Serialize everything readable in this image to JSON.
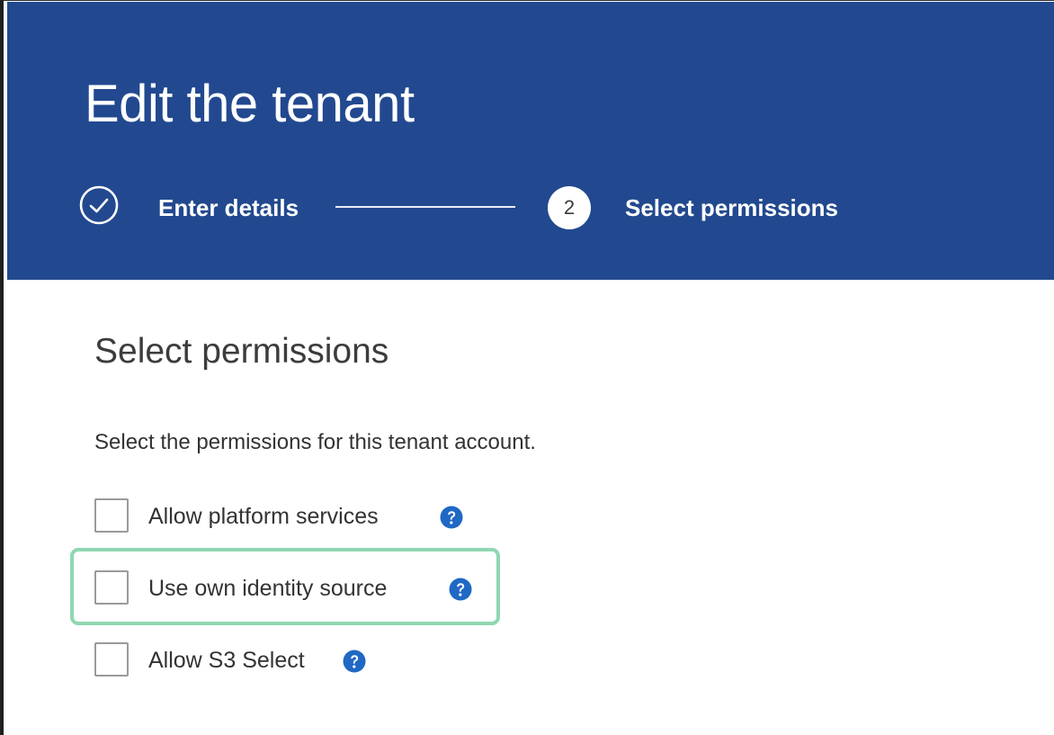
{
  "header": {
    "title": "Edit the tenant",
    "background_color": "#22498f"
  },
  "stepper": {
    "steps": [
      {
        "label": "Enter details",
        "state": "completed",
        "icon": "check-circle-icon"
      },
      {
        "number": "2",
        "label": "Select permissions",
        "state": "active"
      }
    ]
  },
  "content": {
    "section_title": "Select permissions",
    "description": "Select the permissions for this tenant account.",
    "options": [
      {
        "label": "Allow platform services",
        "checked": false,
        "help_icon": "question-circle-icon"
      },
      {
        "label": "Use own identity source",
        "checked": false,
        "help_icon": "question-circle-icon",
        "highlighted": true
      },
      {
        "label": "Allow S3 Select",
        "checked": false,
        "help_icon": "question-circle-icon"
      }
    ]
  },
  "colors": {
    "help_icon": "#1f68c4",
    "highlight_border": "#8fd7b2"
  }
}
